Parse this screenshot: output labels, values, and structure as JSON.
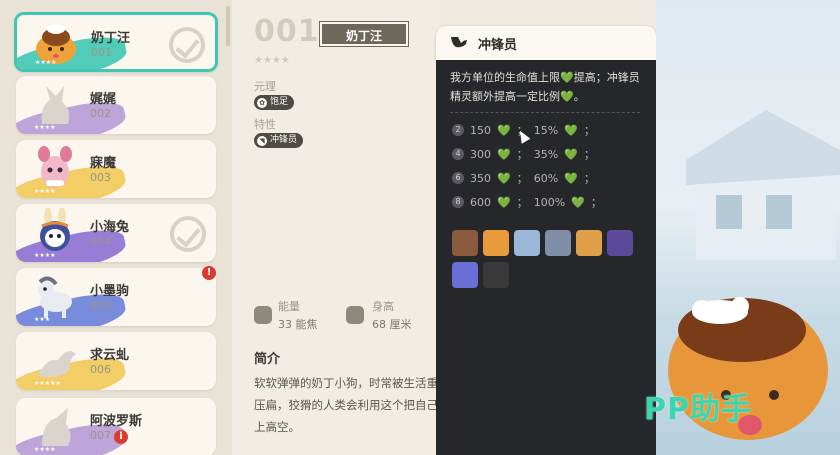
{
  "sidebar": {
    "items": [
      {
        "name": "奶丁汪",
        "number": "001",
        "stars": "★★★★",
        "selected": true,
        "checked": true,
        "accent": "#3fc7b3"
      },
      {
        "name": "娓娓",
        "number": "002",
        "stars": "★★★★",
        "checked": false,
        "accent": "#b79bd6"
      },
      {
        "name": "寐魔",
        "number": "003",
        "stars": "★★★★",
        "checked": false,
        "accent": "#f2c857"
      },
      {
        "name": "小海兔",
        "number": "004",
        "stars": "★★★★",
        "checked": true,
        "accent": "#8c6fd1"
      },
      {
        "name": "小墨驹",
        "number": "005",
        "stars": "★★★",
        "checked": false,
        "alert": "!",
        "accent": "#6a7fd8"
      },
      {
        "name": "求云虬",
        "number": "006",
        "stars": "★★★★★",
        "checked": false,
        "accent": "#f2c857"
      },
      {
        "name": "阿波罗斯",
        "number": "007",
        "stars": "★★★★",
        "checked": false,
        "alert": "i",
        "accent": "#b79bd6"
      }
    ]
  },
  "detail": {
    "number": "001",
    "name": "奶丁汪",
    "stars": "★★★★",
    "element_label": "元理",
    "element_value": "饱足",
    "trait_label": "特性",
    "trait_value": "冲锋员",
    "energy_label": "能量",
    "energy_value": "33 能焦",
    "height_label": "身高",
    "height_value": "68 厘米",
    "intro_title": "简介",
    "intro_text": "软软弹弹的奶丁小狗，时常被生活重负压扁，狡猾的人类会利用这个把自己弹上高空。"
  },
  "popup": {
    "title": "冲锋员",
    "desc_part1": "我方单位的生命值上限",
    "desc_part2": "提高；冲锋员精灵额外提高一定比例",
    "desc_part3": "。",
    "heart": "💚",
    "tiers": [
      {
        "level": "2",
        "base": "150",
        "extra": "15%"
      },
      {
        "level": "4",
        "base": "300",
        "extra": "35%"
      },
      {
        "level": "6",
        "base": "350",
        "extra": "60%"
      },
      {
        "level": "8",
        "base": "600",
        "extra": "100%"
      }
    ],
    "avatar_colors": [
      "#8a5a3c",
      "#e89a3c",
      "#9ab8d8",
      "#7f8fa8",
      "#e0a04a",
      "#5b4a9a",
      "#6a6fd8",
      "#3a3a3a"
    ]
  },
  "watermark": "PP助手",
  "colors": {
    "selected_border": "#3fc7b3",
    "popup_bg": "#26272a",
    "heart_green": "#46c083",
    "alert_red": "#d83b32"
  }
}
